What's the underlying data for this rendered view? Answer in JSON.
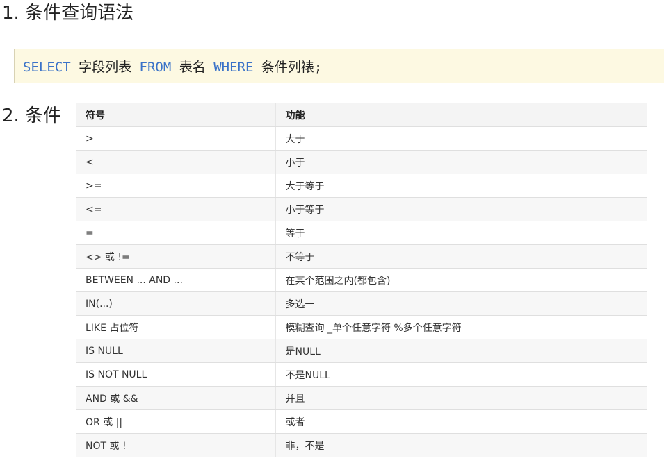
{
  "section1": {
    "title": "1. 条件查询语法"
  },
  "code": {
    "kw_select": "SELECT",
    "text_fields": " 字段列表 ",
    "kw_from": "FROM",
    "text_table": " 表名 ",
    "kw_where": "WHERE",
    "text_conditions": " 条件列裱;"
  },
  "section2": {
    "title": "2. 条件"
  },
  "table": {
    "headers": [
      "符号",
      "功能"
    ],
    "rows": [
      [
        ">",
        "大于"
      ],
      [
        "<",
        "小于"
      ],
      [
        ">=",
        "大于等于"
      ],
      [
        "<=",
        "小于等于"
      ],
      [
        "=",
        "等于"
      ],
      [
        "<> 或 !=",
        "不等于"
      ],
      [
        "BETWEEN ... AND ...",
        "在某个范围之内(都包含)"
      ],
      [
        "IN(...)",
        "多选一"
      ],
      [
        "LIKE 占位符",
        "模糊查询 _单个任意字符  %多个任意字符"
      ],
      [
        "IS NULL",
        "是NULL"
      ],
      [
        "IS NOT NULL",
        "不是NULL"
      ],
      [
        "AND 或 &&",
        "并且"
      ],
      [
        "OR 或 ||",
        "或者"
      ],
      [
        "NOT 或 !",
        "非，不是"
      ]
    ]
  }
}
